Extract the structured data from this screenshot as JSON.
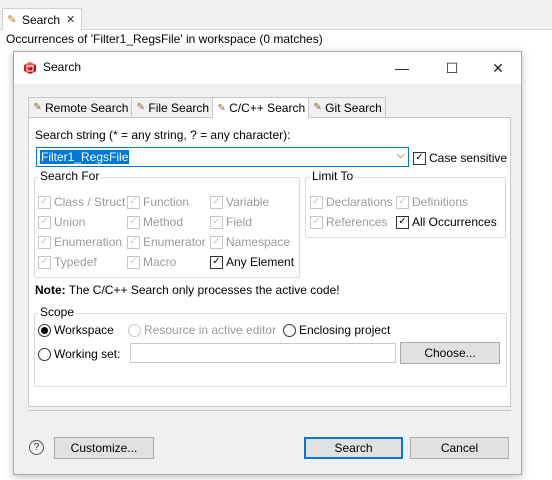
{
  "view": {
    "tab_label": "Search",
    "status": "Occurrences of 'Filter1_RegsFile' in workspace (0 matches)"
  },
  "dialog": {
    "title": "Search",
    "tabs": [
      {
        "label": "Remote Search"
      },
      {
        "label": "File Search"
      },
      {
        "label": "C/C++ Search"
      },
      {
        "label": "Git Search"
      }
    ],
    "search_string_label": "Search string (* = any string, ? = any character):",
    "search_string_value": "Filter1_RegsFile",
    "case_sensitive_label": "Case sensitive",
    "search_for": {
      "title": "Search For",
      "items": [
        {
          "label": "Class / Struct",
          "checked": true,
          "enabled": false
        },
        {
          "label": "Function",
          "checked": true,
          "enabled": false
        },
        {
          "label": "Variable",
          "checked": true,
          "enabled": false
        },
        {
          "label": "Union",
          "checked": true,
          "enabled": false
        },
        {
          "label": "Method",
          "checked": true,
          "enabled": false
        },
        {
          "label": "Field",
          "checked": true,
          "enabled": false
        },
        {
          "label": "Enumeration",
          "checked": true,
          "enabled": false
        },
        {
          "label": "Enumerator",
          "checked": true,
          "enabled": false
        },
        {
          "label": "Namespace",
          "checked": true,
          "enabled": false
        },
        {
          "label": "Typedef",
          "checked": true,
          "enabled": false
        },
        {
          "label": "Macro",
          "checked": true,
          "enabled": false
        },
        {
          "label": "Any Element",
          "checked": true,
          "enabled": true
        }
      ]
    },
    "limit_to": {
      "title": "Limit To",
      "items": [
        {
          "label": "Declarations",
          "checked": true,
          "enabled": false
        },
        {
          "label": "Definitions",
          "checked": true,
          "enabled": false
        },
        {
          "label": "References",
          "checked": true,
          "enabled": false
        },
        {
          "label": "All Occurrences",
          "checked": true,
          "enabled": true
        }
      ]
    },
    "note_bold": "Note:",
    "note_text": " The C/C++ Search only processes the active code!",
    "scope": {
      "title": "Scope",
      "workspace": "Workspace",
      "resource": "Resource in active editor",
      "enclosing": "Enclosing project",
      "working_set": "Working set:",
      "choose": "Choose..."
    },
    "buttons": {
      "customize": "Customize...",
      "search": "Search",
      "cancel": "Cancel"
    },
    "icons": {
      "app": "eclipse-cube-icon",
      "help": "help-icon",
      "minimize": "minimize-icon",
      "maximize": "maximize-icon",
      "close": "close-icon"
    },
    "colors": {
      "accent": "#0078d7",
      "app_icon": "#d41e24"
    }
  }
}
